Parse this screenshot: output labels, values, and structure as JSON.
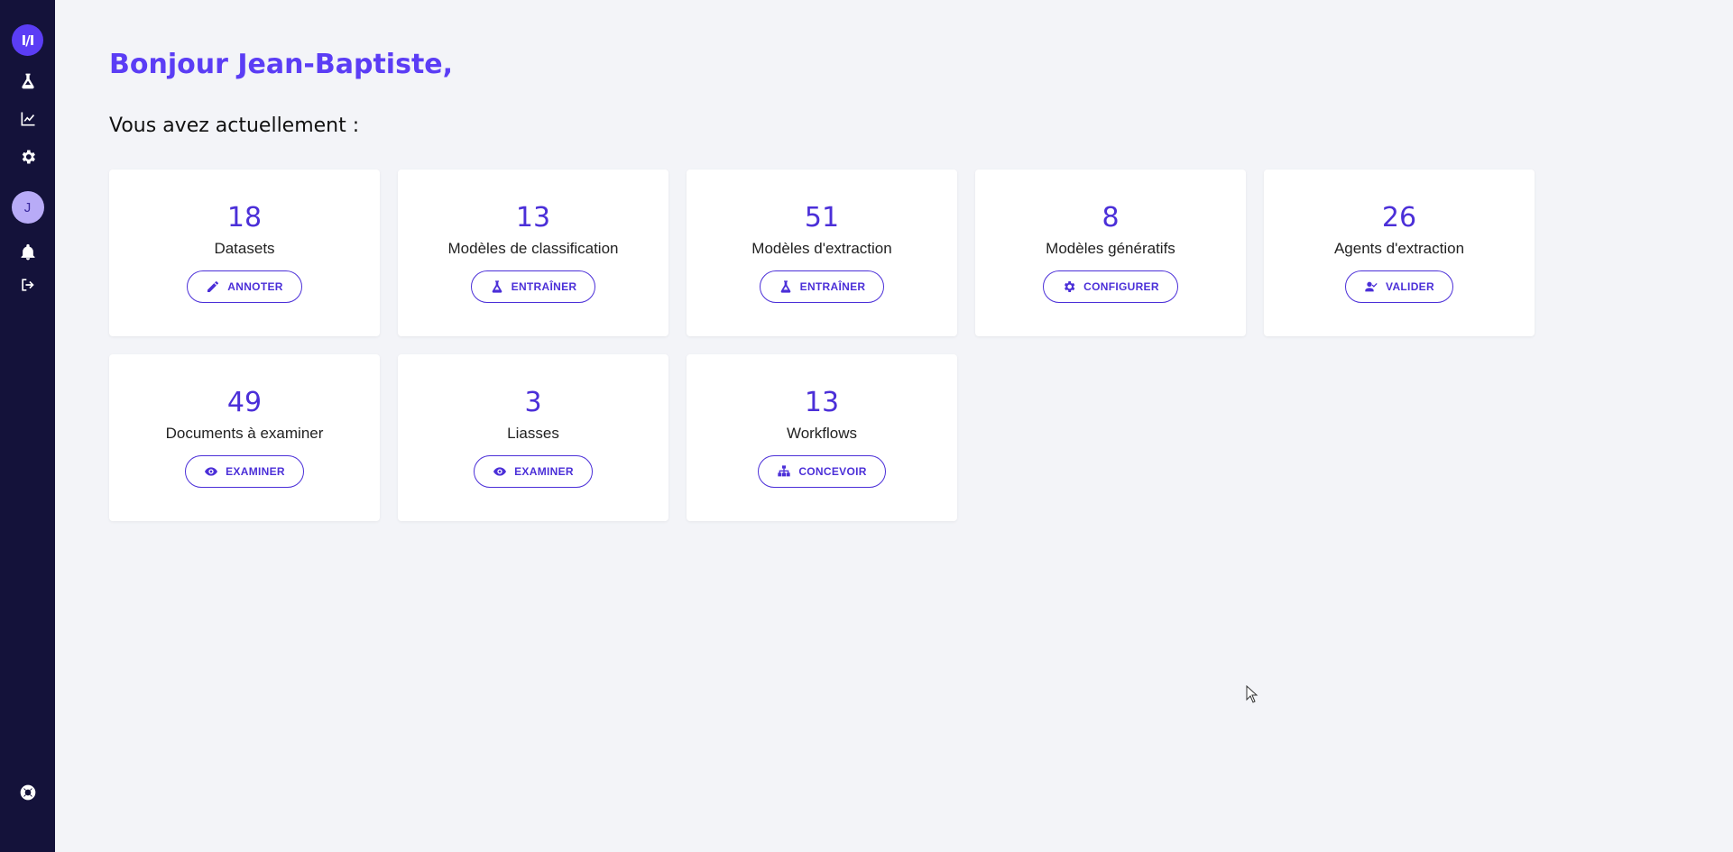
{
  "sidebar": {
    "logo_text": "I/I",
    "user_initial": "J",
    "icons": [
      "flask-icon",
      "chart-line-icon",
      "gear-icon",
      "avatar",
      "bell-icon",
      "sign-out-icon",
      "help-lifebuoy-icon"
    ]
  },
  "header": {
    "greeting": "Bonjour Jean-Baptiste,",
    "subtitle": "Vous avez actuellement :"
  },
  "cards": [
    {
      "count": "18",
      "label": "Datasets",
      "button": "ANNOTER",
      "icon": "pencil-icon"
    },
    {
      "count": "13",
      "label": "Modèles de classification",
      "button": "ENTRAÎNER",
      "icon": "flask-icon"
    },
    {
      "count": "51",
      "label": "Modèles d'extraction",
      "button": "ENTRAÎNER",
      "icon": "flask-icon"
    },
    {
      "count": "8",
      "label": "Modèles génératifs",
      "button": "CONFIGURER",
      "icon": "gear-icon"
    },
    {
      "count": "26",
      "label": "Agents d'extraction",
      "button": "VALIDER",
      "icon": "user-check-icon"
    },
    {
      "count": "49",
      "label": "Documents à examiner",
      "button": "EXAMINER",
      "icon": "eye-icon"
    },
    {
      "count": "3",
      "label": "Liasses",
      "button": "EXAMINER",
      "icon": "eye-icon"
    },
    {
      "count": "13",
      "label": "Workflows",
      "button": "CONCEVOIR",
      "icon": "sitemap-icon"
    }
  ],
  "colors": {
    "sidebar_bg": "#14123a",
    "accent": "#5b3df5",
    "page_bg": "#f3f4f8"
  }
}
